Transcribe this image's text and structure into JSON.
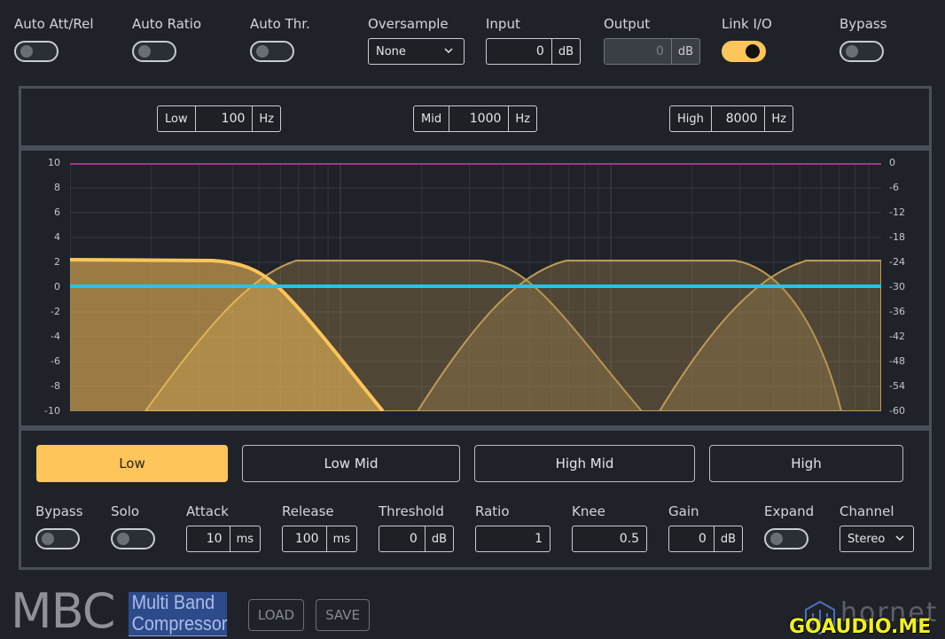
{
  "top": {
    "auto_att_rel": {
      "label": "Auto Att/Rel",
      "on": false
    },
    "auto_ratio": {
      "label": "Auto Ratio",
      "on": false
    },
    "auto_thr": {
      "label": "Auto Thr.",
      "on": false
    },
    "oversample": {
      "label": "Oversample",
      "value": "None"
    },
    "input": {
      "label": "Input",
      "value": "0",
      "unit": "dB"
    },
    "output": {
      "label": "Output",
      "value": "0",
      "unit": "dB"
    },
    "link_io": {
      "label": "Link I/O",
      "on": true
    },
    "bypass": {
      "label": "Bypass",
      "on": false
    }
  },
  "crossover": {
    "low": {
      "label": "Low",
      "value": "100",
      "unit": "Hz"
    },
    "mid": {
      "label": "Mid",
      "value": "1000",
      "unit": "Hz"
    },
    "high": {
      "label": "High",
      "value": "8000",
      "unit": "Hz"
    }
  },
  "graph": {
    "left_ticks": [
      "10",
      "8",
      "6",
      "4",
      "2",
      "0",
      "-2",
      "-4",
      "-6",
      "-8",
      "-10"
    ],
    "right_ticks": [
      "0",
      "-6",
      "-12",
      "-18",
      "-24",
      "-30",
      "-36",
      "-42",
      "-48",
      "-54",
      "-60"
    ],
    "colors": {
      "band_fill": "#a88a4f",
      "band_active": "#fdc55a",
      "gain_line": "#1fc8e8",
      "threshold_line": "#e040c0"
    }
  },
  "bands": {
    "items": [
      {
        "label": "Low",
        "active": true
      },
      {
        "label": "Low Mid",
        "active": false
      },
      {
        "label": "High Mid",
        "active": false
      },
      {
        "label": "High",
        "active": false
      }
    ]
  },
  "controls": {
    "bypass": {
      "label": "Bypass",
      "on": false
    },
    "solo": {
      "label": "Solo",
      "on": false
    },
    "attack": {
      "label": "Attack",
      "value": "10",
      "unit": "ms"
    },
    "release": {
      "label": "Release",
      "value": "100",
      "unit": "ms"
    },
    "threshold": {
      "label": "Threshold",
      "value": "0",
      "unit": "dB"
    },
    "ratio": {
      "label": "Ratio",
      "value": "1"
    },
    "knee": {
      "label": "Knee",
      "value": "0.5"
    },
    "gain": {
      "label": "Gain",
      "value": "0",
      "unit": "dB"
    },
    "expand": {
      "label": "Expand",
      "on": false
    },
    "channel": {
      "label": "Channel",
      "value": "Stereo"
    }
  },
  "footer": {
    "logo_big": "MBC",
    "logo_line1": "Multi Band",
    "logo_line2": "Compressor",
    "load": "LOAD",
    "save": "SAVE",
    "brand": "hornet",
    "watermark": "GOAUDIO.ME"
  }
}
